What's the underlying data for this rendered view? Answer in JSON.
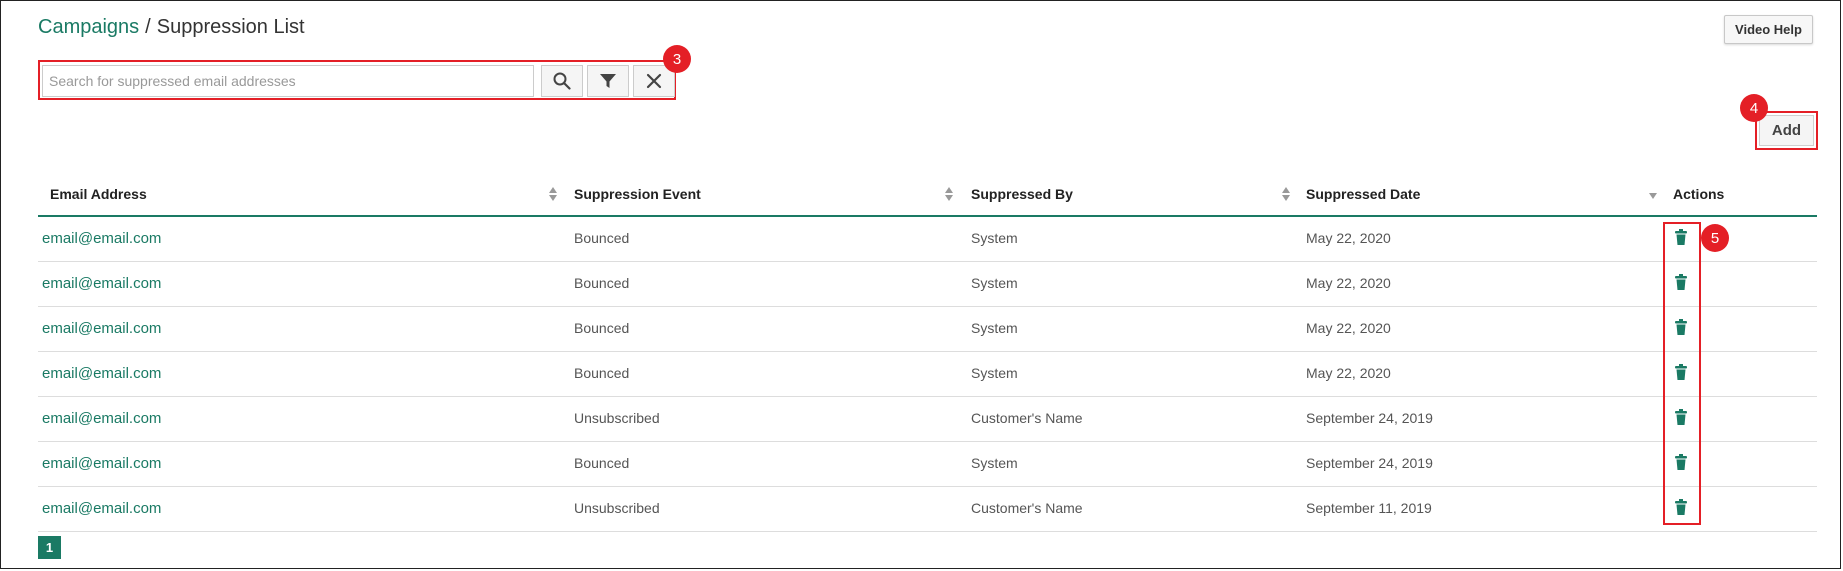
{
  "breadcrumb": {
    "parent": "Campaigns",
    "separator": "/",
    "current": "Suppression List"
  },
  "header": {
    "video_help_label": "Video Help"
  },
  "search": {
    "placeholder": "Search for suppressed email addresses",
    "value": ""
  },
  "toolbar": {
    "add_label": "Add"
  },
  "markers": {
    "search": "3",
    "add": "4",
    "actions": "5"
  },
  "table": {
    "columns": [
      "Email Address",
      "Suppression Event",
      "Suppressed By",
      "Suppressed Date",
      "Actions"
    ],
    "rows": [
      {
        "email": "email@email.com",
        "event": "Bounced",
        "by": "System",
        "date": "May 22, 2020"
      },
      {
        "email": "email@email.com",
        "event": "Bounced",
        "by": "System",
        "date": "May 22, 2020"
      },
      {
        "email": "email@email.com",
        "event": "Bounced",
        "by": "System",
        "date": "May 22, 2020"
      },
      {
        "email": "email@email.com",
        "event": "Bounced",
        "by": "System",
        "date": "May 22, 2020"
      },
      {
        "email": "email@email.com",
        "event": "Unsubscribed",
        "by": "Customer's Name",
        "date": "September 24, 2019"
      },
      {
        "email": "email@email.com",
        "event": "Bounced",
        "by": "System",
        "date": "September 24, 2019"
      },
      {
        "email": "email@email.com",
        "event": "Unsubscribed",
        "by": "Customer's Name",
        "date": "September 11, 2019"
      }
    ]
  },
  "pagination": {
    "current_page": "1"
  },
  "colors": {
    "accent": "#1a7a64",
    "highlight": "#e41f26"
  },
  "icons": {
    "search": "search-icon",
    "filter": "filter-icon",
    "clear": "close-icon",
    "delete": "trash-icon",
    "sort": "sort-icon"
  }
}
